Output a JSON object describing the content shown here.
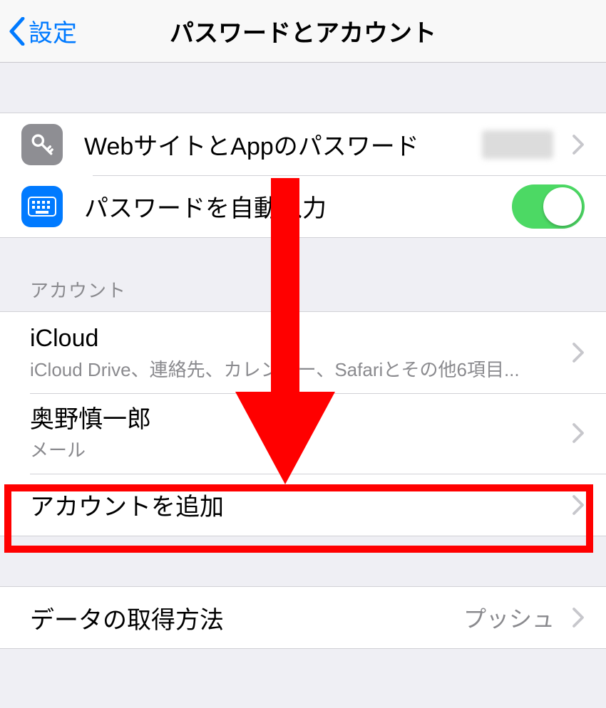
{
  "nav": {
    "back_label": "設定",
    "title": "パスワードとアカウント"
  },
  "section_passwords": {
    "website_passwords_label": "WebサイトとAppのパスワード",
    "autofill_label": "パスワードを自動入力",
    "autofill_on": true
  },
  "section_accounts": {
    "header": "アカウント",
    "items": [
      {
        "title": "iCloud",
        "subtitle": "iCloud Drive、連絡先、カレンダー、Safariとその他6項目..."
      },
      {
        "title": "奥野慎一郎",
        "subtitle": "メール"
      }
    ],
    "add_account_label": "アカウントを追加"
  },
  "section_fetch": {
    "label": "データの取得方法",
    "value": "プッシュ"
  },
  "icons": {
    "key": "key-icon",
    "keyboard": "keyboard-icon"
  }
}
